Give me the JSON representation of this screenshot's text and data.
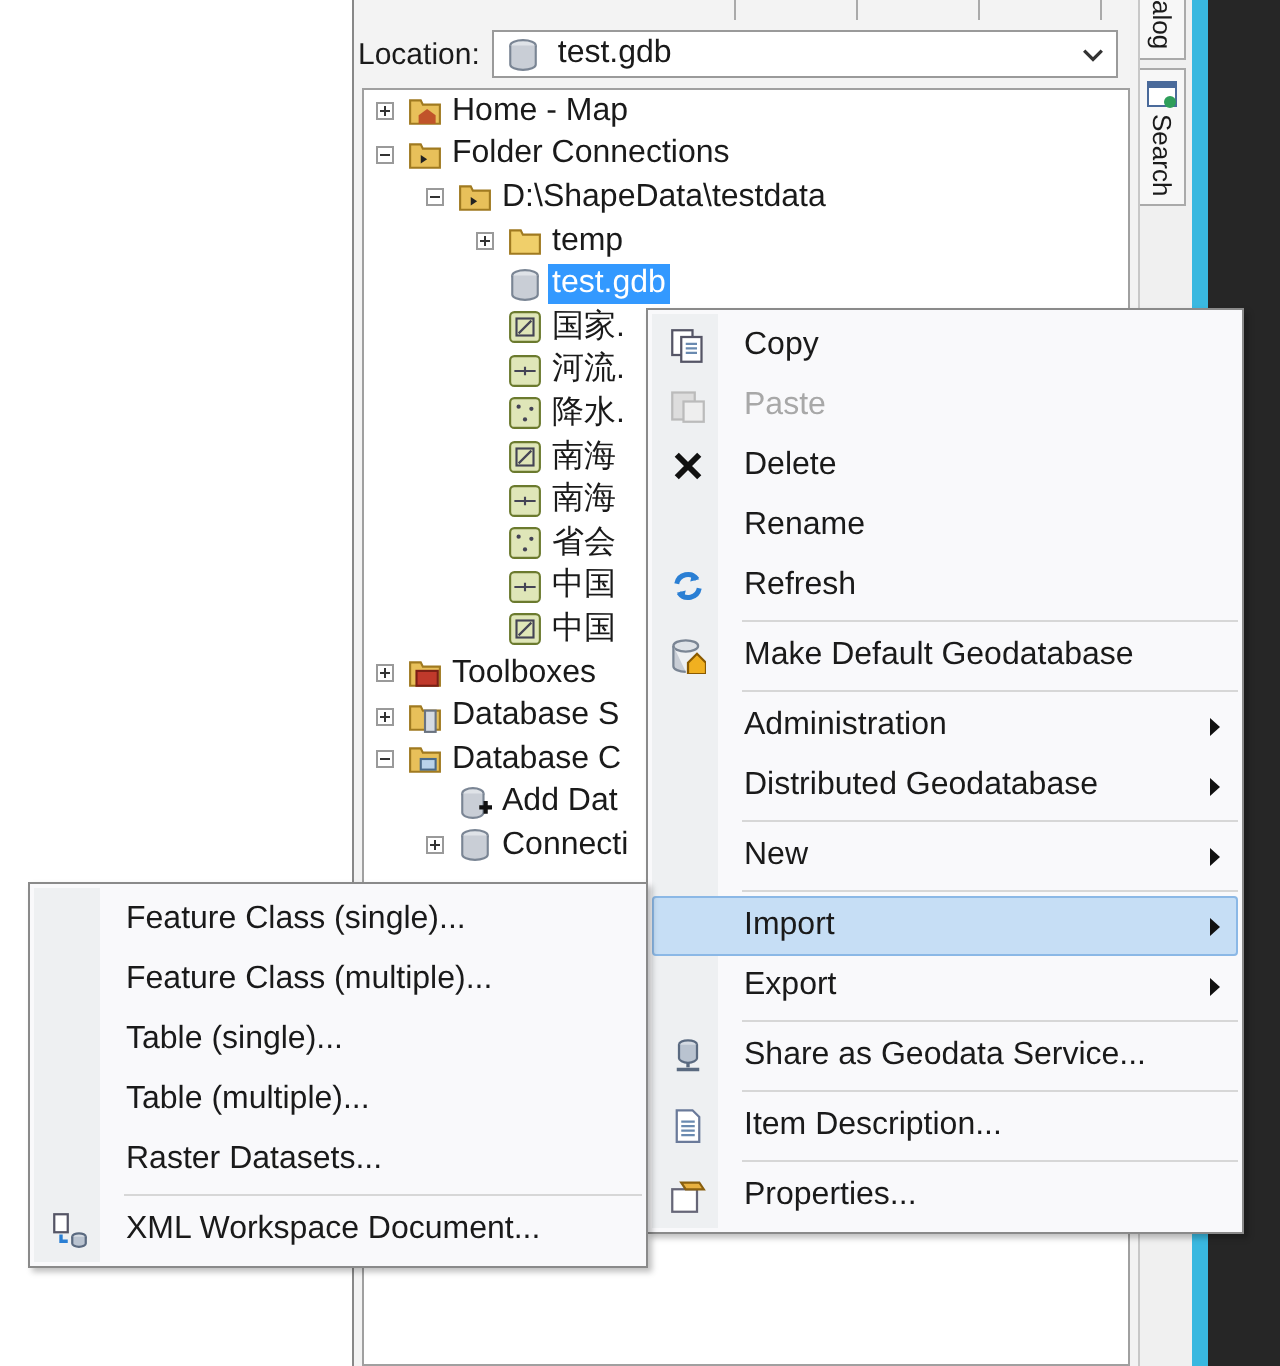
{
  "location": {
    "label": "Location:",
    "value": "test.gdb"
  },
  "tree": [
    {
      "label": "Home - Map",
      "kind": "home",
      "expanded": false,
      "selected": false
    },
    {
      "label": "Folder Connections",
      "kind": "folder_connections",
      "expanded": true,
      "selected": false,
      "children": [
        {
          "label": "D:\\ShapeData\\testdata",
          "kind": "connected_folder",
          "expanded": true,
          "selected": false,
          "children": [
            {
              "label": "temp",
              "kind": "folder",
              "expanded": false,
              "selected": false
            },
            {
              "label": "test.gdb",
              "kind": "geodatabase",
              "selected": true
            },
            {
              "label": "国家.",
              "kind": "polygon",
              "selected": false
            },
            {
              "label": "河流.",
              "kind": "line",
              "selected": false
            },
            {
              "label": "降水.",
              "kind": "point",
              "selected": false
            },
            {
              "label": "南海",
              "kind": "polygon",
              "selected": false
            },
            {
              "label": "南海",
              "kind": "line",
              "selected": false
            },
            {
              "label": "省会",
              "kind": "point",
              "selected": false
            },
            {
              "label": "中国",
              "kind": "line",
              "selected": false
            },
            {
              "label": "中国",
              "kind": "polygon",
              "selected": false
            }
          ]
        }
      ]
    },
    {
      "label": "Toolboxes",
      "kind": "toolboxes",
      "expanded": false,
      "selected": false
    },
    {
      "label": "Database S",
      "kind": "database_servers",
      "expanded": false,
      "selected": false
    },
    {
      "label": "Database C",
      "kind": "database_connections",
      "expanded": true,
      "selected": false,
      "children": [
        {
          "label": "Add Dat",
          "kind": "add_connection",
          "selected": false
        },
        {
          "label": "Connecti",
          "kind": "connection",
          "expanded": false,
          "selected": false
        }
      ]
    }
  ],
  "side_tabs": [
    {
      "label": "alog"
    },
    {
      "label": "Search"
    }
  ],
  "context_menu": {
    "groups": [
      [
        {
          "label": "Copy",
          "disabled": false,
          "selected": false
        },
        {
          "label": "Paste",
          "disabled": true,
          "selected": false
        },
        {
          "label": "Delete",
          "disabled": false,
          "selected": false
        },
        {
          "label": "Rename",
          "disabled": false,
          "selected": false
        },
        {
          "label": "Refresh",
          "disabled": false,
          "selected": false
        }
      ],
      [
        {
          "label": "Make Default Geodatabase",
          "disabled": false,
          "selected": false
        }
      ],
      [
        {
          "label": "Administration",
          "disabled": false,
          "selected": false,
          "submenu": true
        },
        {
          "label": "Distributed Geodatabase",
          "disabled": false,
          "selected": false,
          "submenu": true
        }
      ],
      [
        {
          "label": "New",
          "disabled": false,
          "selected": false,
          "submenu": true
        }
      ],
      [
        {
          "label": "Import",
          "disabled": false,
          "selected": true,
          "submenu": true
        },
        {
          "label": "Export",
          "disabled": false,
          "selected": false,
          "submenu": true
        }
      ],
      [
        {
          "label": "Share as Geodata Service...",
          "disabled": false,
          "selected": false
        }
      ],
      [
        {
          "label": "Item Description...",
          "disabled": false,
          "selected": false
        }
      ],
      [
        {
          "label": "Properties...",
          "disabled": false,
          "selected": false
        }
      ]
    ]
  },
  "import_submenu": {
    "groups": [
      [
        {
          "label": "Feature Class (single)...",
          "disabled": false,
          "selected": false
        },
        {
          "label": "Feature Class (multiple)...",
          "disabled": false,
          "selected": false
        },
        {
          "label": "Table (single)...",
          "disabled": false,
          "selected": false
        },
        {
          "label": "Table (multiple)...",
          "disabled": false,
          "selected": false
        },
        {
          "label": "Raster Datasets...",
          "disabled": false,
          "selected": false
        }
      ],
      [
        {
          "label": "XML Workspace Document...",
          "disabled": false,
          "selected": false
        }
      ]
    ]
  }
}
